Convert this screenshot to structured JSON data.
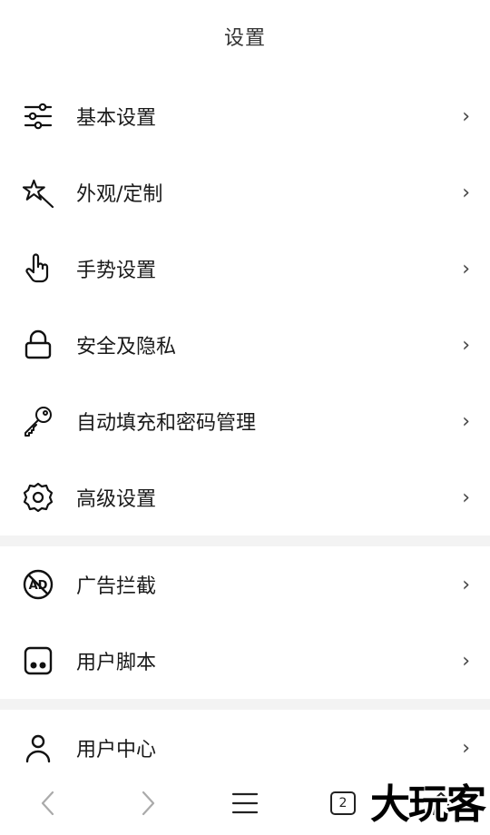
{
  "header": {
    "title": "设置"
  },
  "groups": [
    {
      "items": [
        {
          "label": "基本设置",
          "icon": "sliders-icon"
        },
        {
          "label": "外观/定制",
          "icon": "magic-wand-icon"
        },
        {
          "label": "手势设置",
          "icon": "hand-pointer-icon"
        },
        {
          "label": "安全及隐私",
          "icon": "lock-icon"
        },
        {
          "label": "自动填充和密码管理",
          "icon": "key-icon"
        },
        {
          "label": "高级设置",
          "icon": "gear-icon"
        }
      ]
    },
    {
      "items": [
        {
          "label": "广告拦截",
          "icon": "ad-block-icon"
        },
        {
          "label": "用户脚本",
          "icon": "script-icon"
        }
      ]
    },
    {
      "items": [
        {
          "label": "用户中心",
          "icon": "user-icon"
        }
      ]
    }
  ],
  "chevron": "›",
  "bottom_bar": {
    "tab_count": "2"
  },
  "watermark": "大玩客"
}
